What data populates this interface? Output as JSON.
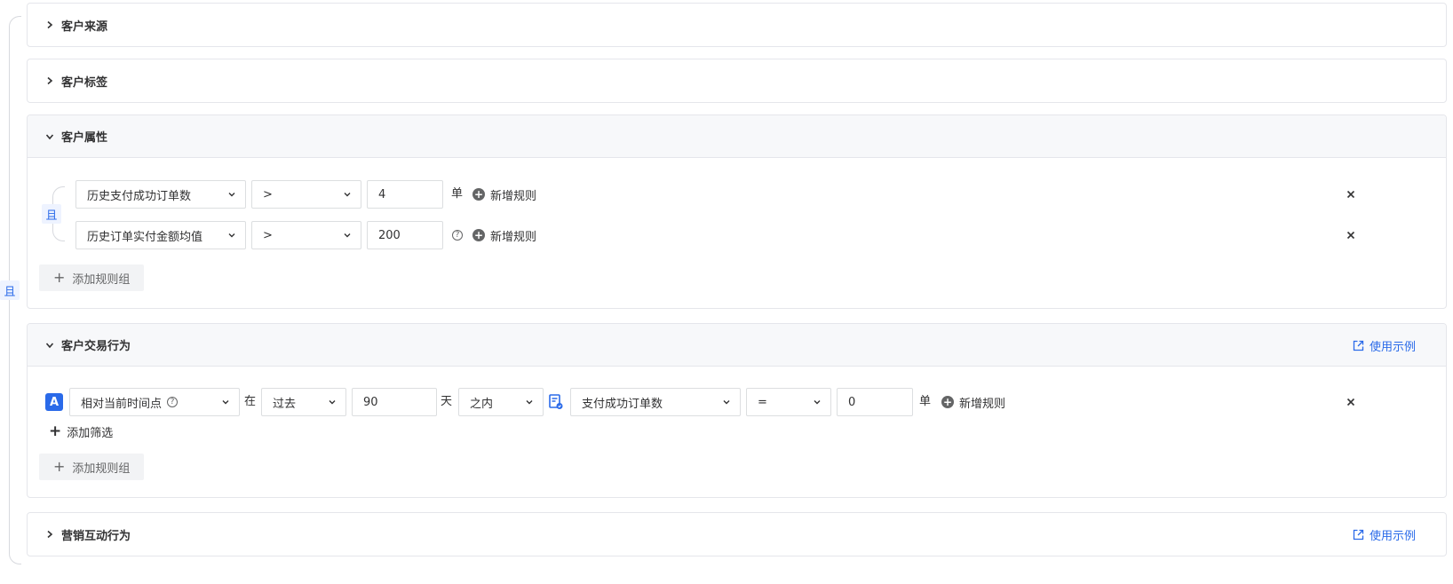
{
  "logic_and": "且",
  "panels": {
    "source": {
      "title": "客户来源"
    },
    "tags": {
      "title": "客户标签"
    },
    "attributes": {
      "title": "客户属性",
      "group_and": "且",
      "rules": [
        {
          "field": "历史支付成功订单数",
          "operator": ">",
          "value": "4",
          "unit": "单",
          "add_label": "新增规则"
        },
        {
          "field": "历史订单实付金额均值",
          "operator": ">",
          "value": "200",
          "add_label": "新增规则"
        }
      ],
      "add_group_label": "添加规则组"
    },
    "transaction": {
      "title": "客户交易行为",
      "example_label": "使用示例",
      "rule": {
        "badge": "A",
        "time_ref": "相对当前时间点",
        "at_label": "在",
        "period": "过去",
        "days": "90",
        "day_unit": "天",
        "range": "之内",
        "metric": "支付成功订单数",
        "operator": "=",
        "value": "0",
        "unit": "单",
        "add_label": "新增规则"
      },
      "add_filter_label": "添加筛选",
      "add_group_label": "添加规则组"
    },
    "marketing": {
      "title": "营销互动行为",
      "example_label": "使用示例"
    }
  },
  "colors": {
    "accent": "#2a6ae9",
    "border": "#e5e6eb",
    "header_bg": "#f7f8fa"
  }
}
